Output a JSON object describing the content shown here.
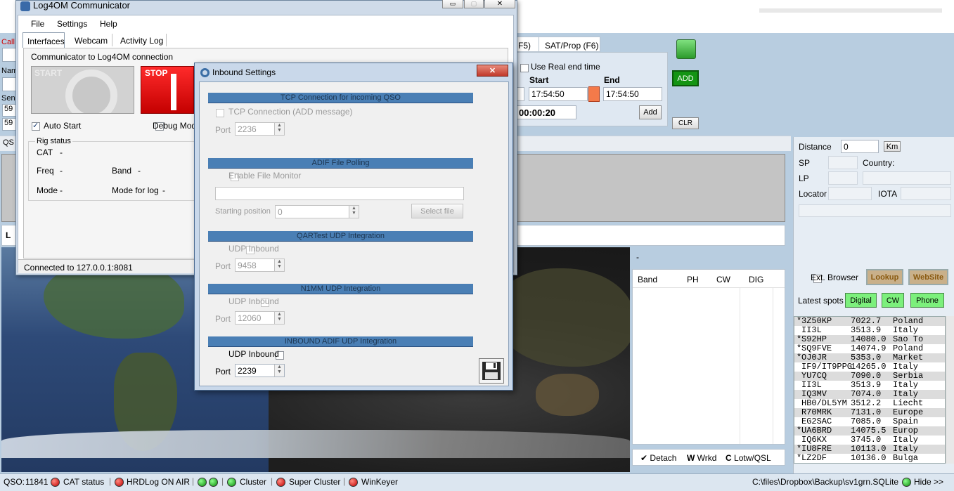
{
  "main_window": {
    "tabs": [
      "F5)",
      "SAT/Prop (F6)"
    ],
    "use_real_end_time": "Use Real end time",
    "start_label": "Start",
    "end_label": "End",
    "start_time": "17:54:50",
    "end_time": "17:54:50",
    "duration": "00:00:20",
    "add_label": "Add",
    "add_green_label": "ADD",
    "clr_label": "CLR",
    "dash": "-",
    "left_fragments": {
      "call": "Call",
      "name": "Nam",
      "sent": "Sen",
      "rst1": "59",
      "rst2": "59",
      "qso": "QS",
      "l": "L"
    },
    "panel": {
      "distance_label": "Distance",
      "distance_value": "0",
      "km_label": "Km",
      "sp_label": "SP",
      "lp_label": "LP",
      "country_label": "Country:",
      "locator_label": "Locator",
      "iota_label": "IOTA",
      "ext_browser_label": "Ext. Browser",
      "lookup_label": "Lookup",
      "website_label": "WebSite",
      "latest_spots_label": "Latest spots",
      "digital_label": "Digital",
      "cw_label": "CW",
      "phone_label": "Phone"
    },
    "band_table": {
      "headers": [
        "Band",
        "PH",
        "CW",
        "DIG"
      ]
    },
    "detach_bar": {
      "detach": "Detach",
      "wrkd_key": "W",
      "wrkd": "Wrkd",
      "lotw_key": "C",
      "lotw": "Lotw/QSL"
    },
    "spots": [
      {
        "mark": "*",
        "call": "3Z50KP",
        "freq": "7022.7",
        "country": "Poland"
      },
      {
        "mark": " ",
        "call": "II3L",
        "freq": "3513.9",
        "country": "Italy"
      },
      {
        "mark": "*",
        "call": "S92HP",
        "freq": "14080.0",
        "country": "Sao To"
      },
      {
        "mark": "*",
        "call": "SQ9FVE",
        "freq": "14074.9",
        "country": "Poland"
      },
      {
        "mark": "*",
        "call": "OJ0JR",
        "freq": "5353.0",
        "country": "Market"
      },
      {
        "mark": " ",
        "call": "IF9/IT9PPG",
        "freq": "14265.0",
        "country": "Italy"
      },
      {
        "mark": " ",
        "call": "YU7CQ",
        "freq": "7090.0",
        "country": "Serbia"
      },
      {
        "mark": " ",
        "call": "II3L",
        "freq": "3513.9",
        "country": "Italy"
      },
      {
        "mark": " ",
        "call": "IQ3MV",
        "freq": "7074.0",
        "country": "Italy"
      },
      {
        "mark": " ",
        "call": "HB0/DL5YM",
        "freq": "3512.2",
        "country": "Liecht"
      },
      {
        "mark": " ",
        "call": "R70MRK",
        "freq": "7131.0",
        "country": "Europe"
      },
      {
        "mark": " ",
        "call": "EG2SAC",
        "freq": "7085.0",
        "country": "Spain"
      },
      {
        "mark": "*",
        "call": "UA6BRD",
        "freq": "14075.5",
        "country": "Europ"
      },
      {
        "mark": " ",
        "call": "IQ6KX",
        "freq": "3745.0",
        "country": "Italy"
      },
      {
        "mark": "*",
        "call": "IU8FRE",
        "freq": "10113.0",
        "country": "Italy"
      },
      {
        "mark": "*",
        "call": "LZ2DF",
        "freq": "10136.0",
        "country": "Bulga"
      }
    ]
  },
  "status_bar": {
    "qso_label": "QSO:",
    "qso_count": "11841",
    "cat": "CAT status",
    "hrdlog": "HRDLog ON AIR",
    "cluster": "Cluster",
    "super_cluster": "Super Cluster",
    "winkeyer": "WinKeyer",
    "path": "C:\\files\\Dropbox\\Backup\\sv1grn.SQLite",
    "hide": "Hide >>"
  },
  "communicator": {
    "title": "Log4OM Communicator",
    "menu": [
      "File",
      "Settings",
      "Help"
    ],
    "tabs": [
      "Interfaces",
      "Webcam",
      "Activity Log"
    ],
    "group_label": "Communicator to Log4OM connection",
    "start_label": "START",
    "stop_label": "STOP",
    "auto_start": "Auto Start",
    "debug_mode": "Debug Mode",
    "rig_status": "Rig status",
    "cat_label": "CAT",
    "freq_label": "Freq",
    "band_label": "Band",
    "mode_label": "Mode",
    "mode_for_log": "Mode for log",
    "dash": "-",
    "connected": "Connected to 127.0.0.1:8081"
  },
  "inbound": {
    "title": "Inbound Settings",
    "tcp_header": "TCP Connection for incoming QSO",
    "tcp_check": "TCP Connection (ADD message)",
    "tcp_port": "2236",
    "adif_header": "ADIF File Polling",
    "adif_check": "Enable File Monitor",
    "starting_position_label": "Starting position",
    "starting_position": "0",
    "select_file": "Select file",
    "qartest_header": "QARTest UDP Integration",
    "qartest_check": "UDP Inbound",
    "qartest_port": "9458",
    "n1mm_header": "N1MM UDP Integration",
    "n1mm_check": "UDP Inbound",
    "n1mm_port": "12060",
    "adif_udp_header": "INBOUND ADIF UDP Integration",
    "adif_udp_check": "UDP Inbound",
    "adif_udp_port": "2239",
    "port_label": "Port"
  }
}
